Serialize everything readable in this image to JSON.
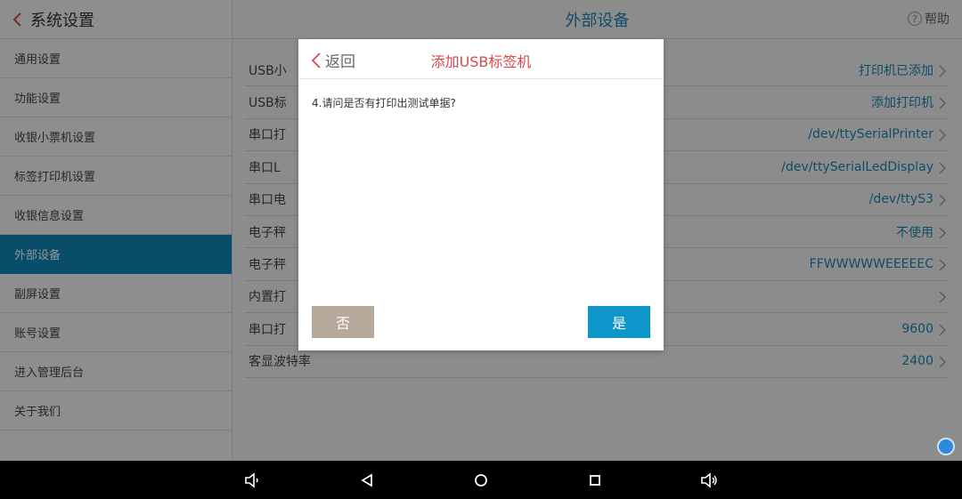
{
  "sidebar": {
    "title": "系统设置",
    "items": [
      {
        "label": "通用设置"
      },
      {
        "label": "功能设置"
      },
      {
        "label": "收银小票机设置"
      },
      {
        "label": "标签打印机设置"
      },
      {
        "label": "收银信息设置"
      },
      {
        "label": "外部设备",
        "active": true
      },
      {
        "label": "副屏设置"
      },
      {
        "label": "账号设置"
      },
      {
        "label": "进入管理后台"
      },
      {
        "label": "关于我们"
      }
    ]
  },
  "main": {
    "title": "外部设备",
    "help_label": "帮助",
    "help_glyph": "?",
    "rows": [
      {
        "label": "USB小",
        "value": "打印机已添加"
      },
      {
        "label": "USB标",
        "value": "添加打印机"
      },
      {
        "label": "串口打",
        "value": "/dev/ttySerialPrinter"
      },
      {
        "label": "串口L",
        "value": "/dev/ttySerialLedDisplay"
      },
      {
        "label": "串口电",
        "value": "/dev/ttyS3"
      },
      {
        "label": "电子秤",
        "value": "不使用"
      },
      {
        "label": "电子秤",
        "value": "FFWWWWWEEEEEC"
      },
      {
        "label": "内置打",
        "value": ""
      },
      {
        "label": "串口打",
        "value": "9600"
      },
      {
        "label": "客显波特率",
        "value": "2400"
      }
    ]
  },
  "dialog": {
    "back_label": "返回",
    "title": "添加USB标签机",
    "question": "4.请问是否有打印出测试单据?",
    "no_label": "否",
    "yes_label": "是"
  },
  "colors": {
    "accent": "#0e86b5",
    "dialog_title": "#d9484b",
    "btn_no": "#b6a89a",
    "btn_yes": "#0e95c9"
  },
  "icons": {
    "back": "chevron-left-icon",
    "row_arrow": "chevron-right-icon",
    "help": "question-circle-icon",
    "nav_volume_down": "volume-down-icon",
    "nav_back": "triangle-back-icon",
    "nav_home": "circle-home-icon",
    "nav_recents": "square-recents-icon",
    "nav_volume_up": "volume-up-icon"
  }
}
